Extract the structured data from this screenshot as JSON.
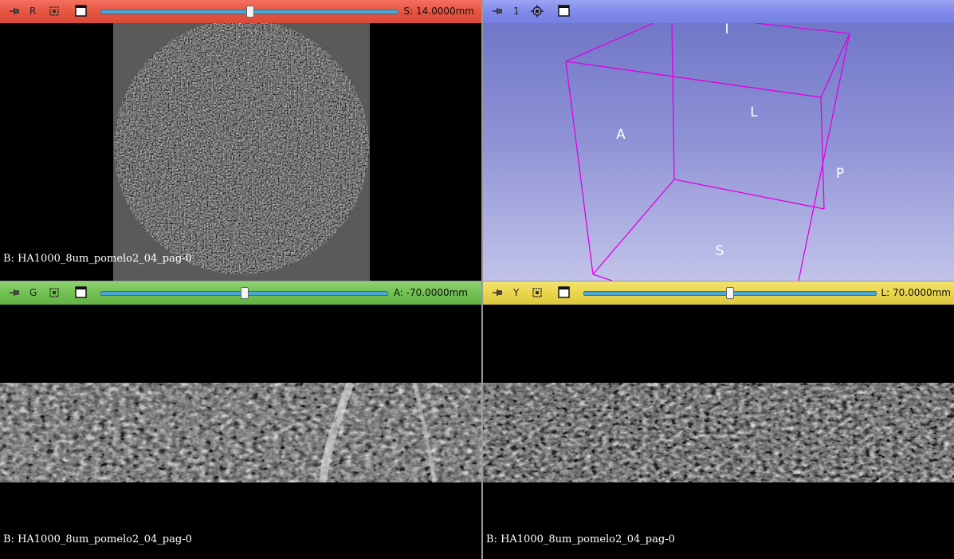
{
  "colors": {
    "red": "#e6533f",
    "blue": "#8089ea",
    "green": "#6fbf4f",
    "yellow": "#e8d44a",
    "box": "#e000e0"
  },
  "red_view": {
    "letter": "R",
    "offset": "S: 14.0000mm",
    "slider_fraction": 0.5,
    "background_label": "B: HA1000_8um_pomelo2_04_pag-0"
  },
  "threed_view": {
    "letter": "1",
    "orientation": {
      "inferior": "I",
      "left": "L",
      "anterior": "A",
      "posterior": "P",
      "superior": "S"
    }
  },
  "green_view": {
    "letter": "G",
    "offset": "A: -70.0000mm",
    "slider_fraction": 0.5,
    "background_label": "B: HA1000_8um_pomelo2_04_pag-0"
  },
  "yellow_view": {
    "letter": "Y",
    "offset": "L: 70.0000mm",
    "slider_fraction": 0.5,
    "background_label": "B: HA1000_8um_pomelo2_04_pag-0"
  },
  "icons": {
    "pin": "pin-icon",
    "link": "link-icon",
    "window": "window-layout-icon",
    "center": "center-view-icon"
  }
}
